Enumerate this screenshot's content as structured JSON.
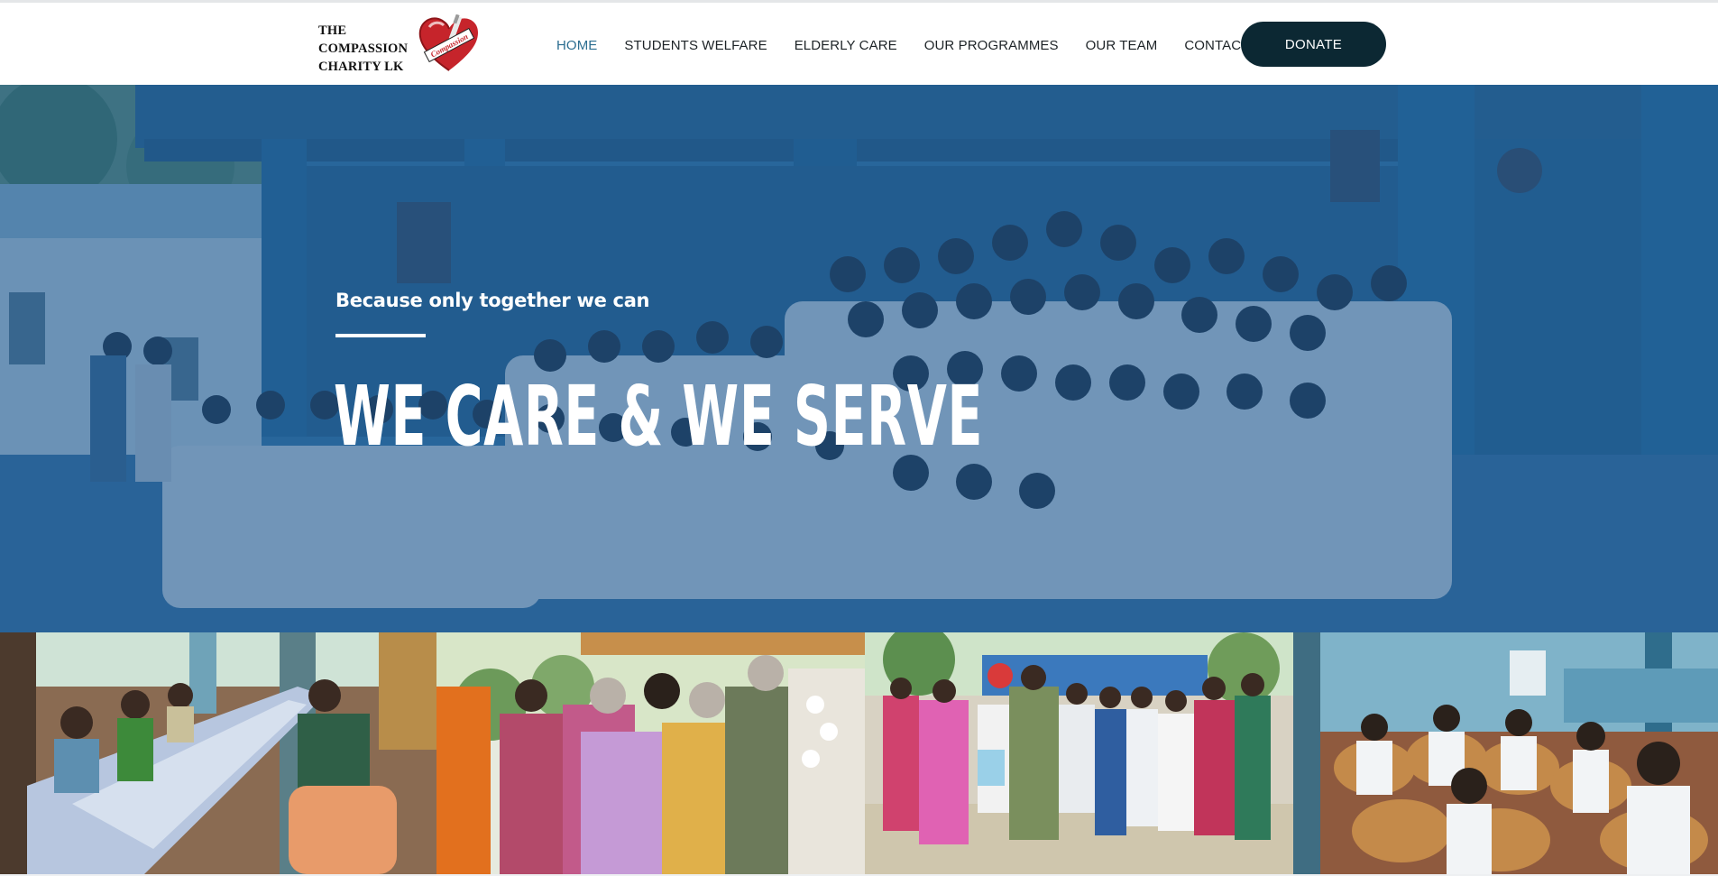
{
  "site": {
    "logo_lines": [
      "THE",
      "COMPASSION",
      "CHARITY LK"
    ],
    "logo_badge": "Compassion"
  },
  "nav": {
    "items": [
      {
        "label": "HOME",
        "active": true
      },
      {
        "label": "STUDENTS WELFARE",
        "active": false
      },
      {
        "label": "ELDERLY CARE",
        "active": false
      },
      {
        "label": "OUR PROGRAMMES",
        "active": false
      },
      {
        "label": "OUR TEAM",
        "active": false
      },
      {
        "label": "CONTACT US",
        "active": false
      }
    ],
    "donate_label": "DONATE"
  },
  "hero": {
    "subtitle": "Because only together we can",
    "title": "We Care & We Serve"
  },
  "colors": {
    "accent": "#2c6e91",
    "donate_bg": "#0c2833",
    "hero_overlay": "#19528a",
    "heart_red": "#c6242b"
  },
  "gallery": {
    "photos": [
      {
        "name": "elderly-dining-photo"
      },
      {
        "name": "elderly-group-prayer-photo"
      },
      {
        "name": "students-donation-photo"
      },
      {
        "name": "students-seated-photo"
      }
    ]
  }
}
